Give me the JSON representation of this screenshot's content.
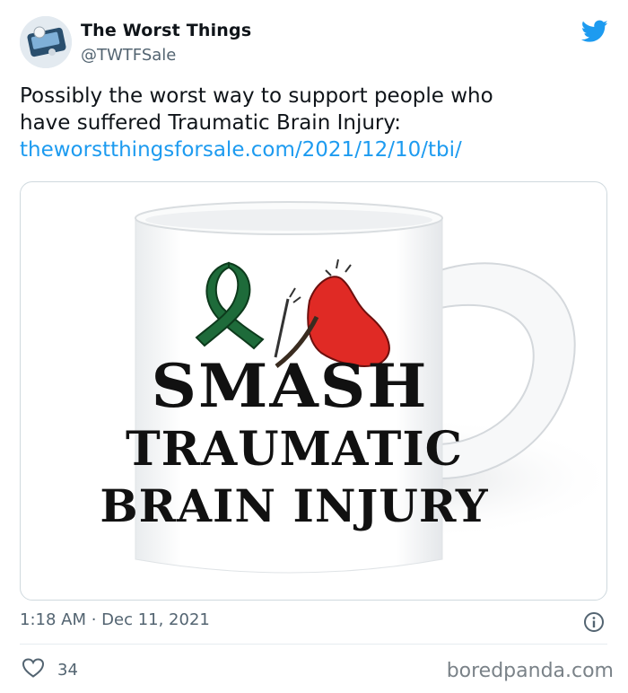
{
  "tweet": {
    "display_name": "The Worst Things",
    "handle": "@TWTFSale",
    "text_line1": "Possibly the worst way to support people who",
    "text_line2": "have suffered Traumatic Brain Injury:",
    "link": "theworstthingsforsale.com/2021/12/10/tbi/",
    "timestamp": "1:18 AM · Dec 11, 2021",
    "like_count": "34"
  },
  "media": {
    "mug_text_line1": "SMASH",
    "mug_text_line2": "TRAUMATIC",
    "mug_text_line3": "BRAIN INJURY"
  },
  "colors": {
    "twitter_blue": "#1d9bf0",
    "ribbon_green": "#1e6b3a",
    "cardinal_red": "#e02a25"
  },
  "icons": [
    "twitter-bird-icon",
    "info-icon",
    "heart-icon"
  ],
  "watermark": "boredpanda.com"
}
